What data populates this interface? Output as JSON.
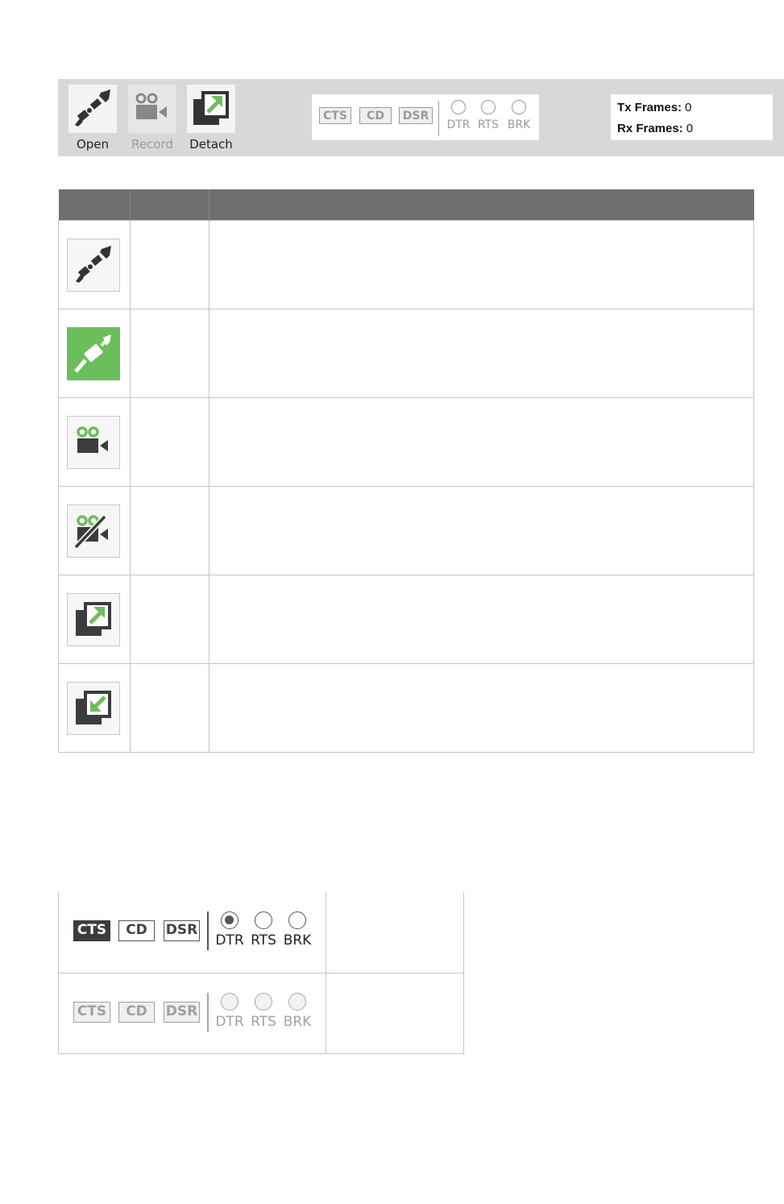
{
  "toolbar": {
    "open_label": "Open",
    "record_label": "Record",
    "detach_label": "Detach",
    "signals": [
      "CTS",
      "CD",
      "DSR"
    ],
    "lines": [
      "DTR",
      "RTS",
      "BRK"
    ],
    "tx_label": "Tx Frames:",
    "tx_value": "0",
    "rx_label": "Rx Frames:",
    "rx_value": "0"
  },
  "icon_table": {
    "rows": [
      {
        "icon": "connector-open-icon"
      },
      {
        "icon": "connector-connected-icon"
      },
      {
        "icon": "record-camera-icon"
      },
      {
        "icon": "record-stop-camera-icon"
      },
      {
        "icon": "detach-window-icon"
      },
      {
        "icon": "attach-window-icon"
      }
    ]
  },
  "signal_states": {
    "row1": {
      "signals": [
        "CTS",
        "CD",
        "DSR"
      ],
      "lines": [
        "DTR",
        "RTS",
        "BRK"
      ]
    },
    "row2": {
      "signals": [
        "CTS",
        "CD",
        "DSR"
      ],
      "lines": [
        "DTR",
        "RTS",
        "BRK"
      ]
    }
  },
  "colors": {
    "accent_green": "#6cbe5b",
    "header_gray": "#6f6f6f",
    "icon_dark": "#3c3c3c"
  }
}
